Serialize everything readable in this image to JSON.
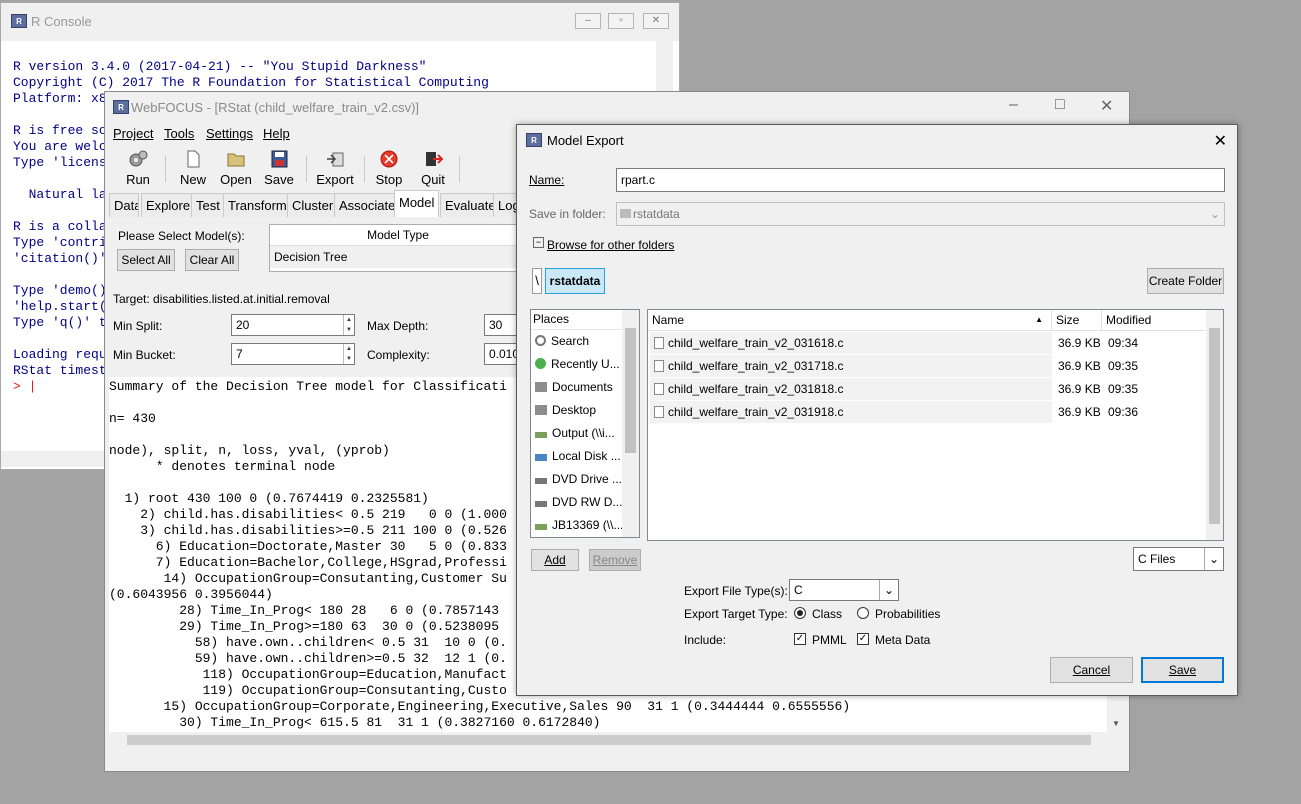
{
  "r_console": {
    "title": "R Console",
    "lines": [
      "R version 3.4.0 (2017-04-21) -- \"You Stupid Darkness\"",
      "Copyright (C) 2017 The R Foundation for Statistical Computing",
      "Platform: x8",
      "",
      "R is free so",
      "You are welc",
      "Type 'licens",
      "",
      "  Natural la",
      "",
      "R is a colla",
      "Type 'contri",
      "'citation()'",
      "",
      "Type 'demo()",
      "'help.start(",
      "Type 'q()' t",
      "",
      "Loading requ",
      "RStat timest"
    ],
    "prompt": ">"
  },
  "webfocus": {
    "title": "WebFOCUS - [RStat (child_welfare_train_v2.csv)]",
    "menu": [
      "Project",
      "Tools",
      "Settings",
      "Help"
    ],
    "toolbar": [
      "Run",
      "New",
      "Open",
      "Save",
      "Export",
      "Stop",
      "Quit"
    ],
    "tabs": [
      "Data",
      "Explore",
      "Test",
      "Transform",
      "Cluster",
      "Associate",
      "Model",
      "Evaluate",
      "Log"
    ],
    "active_tab": "Model",
    "select_label": "Please Select Model(s):",
    "select_all": "Select All",
    "clear_all": "Clear All",
    "model_type_header": "Model Type",
    "model_type_value": "Decision Tree",
    "target": "Target: disabilities.listed.at.initial.removal",
    "min_split_label": "Min Split:",
    "min_split": "20",
    "max_depth_label": "Max Depth:",
    "max_depth": "30",
    "min_bucket_label": "Min Bucket:",
    "min_bucket": "7",
    "complexity_label": "Complexity:",
    "complexity": "0.010",
    "summary_lines": [
      "Summary of the Decision Tree model for Classificati",
      "",
      "n= 430",
      "",
      "node), split, n, loss, yval, (yprob)",
      "      * denotes terminal node",
      "",
      "  1) root 430 100 0 (0.7674419 0.2325581)",
      "    2) child.has.disabilities< 0.5 219   0 0 (1.000",
      "    3) child.has.disabilities>=0.5 211 100 0 (0.526",
      "      6) Education=Doctorate,Master 30   5 0 (0.833",
      "      7) Education=Bachelor,College,HSgrad,Professi",
      "       14) OccupationGroup=Consutanting,Customer Su",
      "(0.6043956 0.3956044)",
      "         28) Time_In_Prog< 180 28   6 0 (0.7857143",
      "         29) Time_In_Prog>=180 63  30 0 (0.5238095",
      "           58) have.own..children< 0.5 31  10 0 (0.",
      "           59) have.own..children>=0.5 32  12 1 (0.",
      "            118) OccupationGroup=Education,Manufact",
      "            119) OccupationGroup=Consutanting,Custo",
      "       15) OccupationGroup=Corporate,Engineering,Executive,Sales 90  31 1 (0.3444444 0.6555556)",
      "         30) Time_In_Prog< 615.5 81  31 1 (0.3827160 0.6172840)"
    ]
  },
  "model_export": {
    "title": "Model Export",
    "name_label": "Name:",
    "name_value": "rpart.c",
    "save_in_label": "Save in folder:",
    "save_in_value": "rstatdata",
    "browse_label": "Browse for other folders",
    "path_root": "\\",
    "path_current": "rstatdata",
    "create_folder": "Create Folder",
    "places_header": "Places",
    "places": [
      "Search",
      "Recently U...",
      "Documents",
      "Desktop",
      "Output (\\\\i...",
      "Local Disk ...",
      "DVD Drive ...",
      "DVD RW D...",
      "JB13369 (\\\\..."
    ],
    "columns": [
      "Name",
      "Size",
      "Modified"
    ],
    "files": [
      {
        "name": "child_welfare_train_v2_031618.c",
        "size": "36.9 KB",
        "modified": "09:34"
      },
      {
        "name": "child_welfare_train_v2_031718.c",
        "size": "36.9 KB",
        "modified": "09:35"
      },
      {
        "name": "child_welfare_train_v2_031818.c",
        "size": "36.9 KB",
        "modified": "09:35"
      },
      {
        "name": "child_welfare_train_v2_031918.c",
        "size": "36.9 KB",
        "modified": "09:36"
      }
    ],
    "add": "Add",
    "remove": "Remove",
    "filter": "C Files",
    "file_type_label": "Export File Type(s):",
    "file_type": "C",
    "target_type_label": "Export Target Type:",
    "target_class": "Class",
    "target_prob": "Probabilities",
    "include_label": "Include:",
    "include_pmml": "PMML",
    "include_meta": "Meta Data",
    "cancel": "Cancel",
    "save": "Save"
  }
}
